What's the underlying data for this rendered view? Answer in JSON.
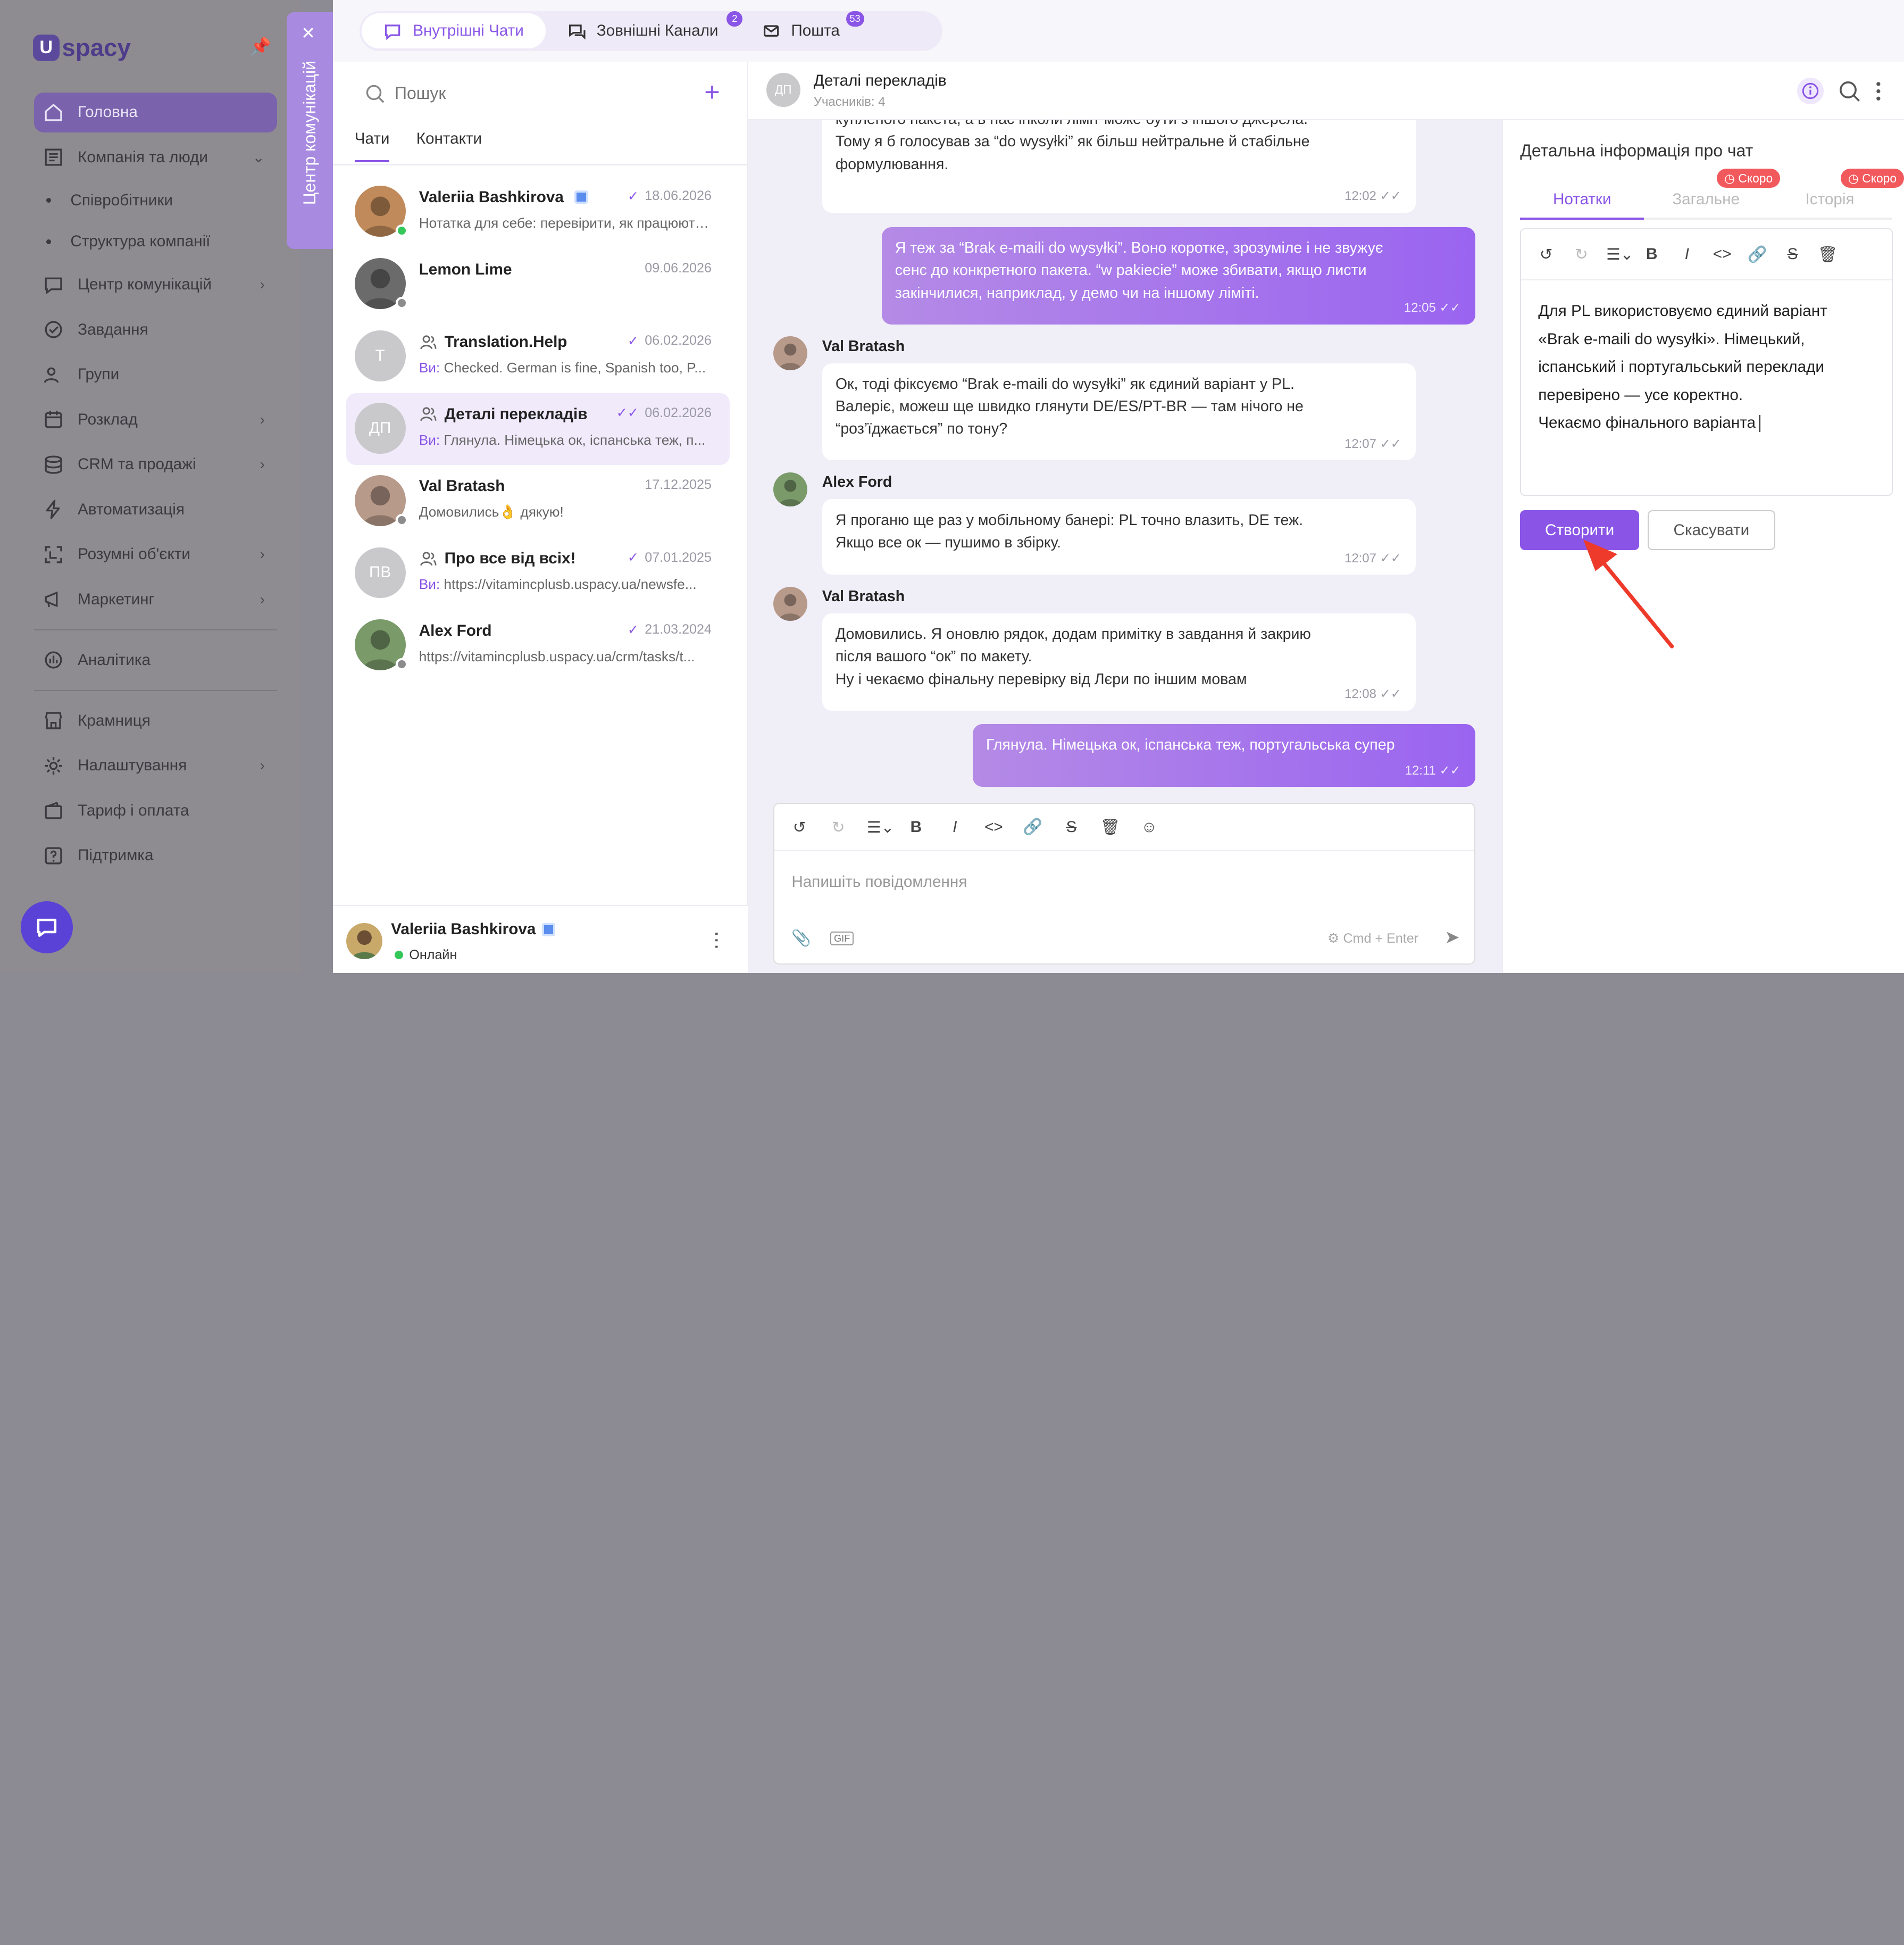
{
  "sidebar": {
    "logo_text": "spacy",
    "logo_mark": "U",
    "items": [
      {
        "label": "Головна",
        "icon": "home-icon",
        "active": true
      },
      {
        "label": "Компанія та люди",
        "icon": "company-icon",
        "expanded": true
      },
      {
        "label": "Співробітники",
        "sub": true
      },
      {
        "label": "Структура компанії",
        "sub": true
      },
      {
        "label": "Центр комунікацій",
        "icon": "chat-icon"
      },
      {
        "label": "Завдання",
        "icon": "check-circle-icon"
      },
      {
        "label": "Групи",
        "icon": "groups-icon"
      },
      {
        "label": "Розклад",
        "icon": "calendar-icon"
      },
      {
        "label": "CRM та продажі",
        "icon": "coins-icon"
      },
      {
        "label": "Автоматизація",
        "icon": "bolt-icon"
      },
      {
        "label": "Розумні об'єкти",
        "icon": "smart-object-icon"
      },
      {
        "label": "Маркетинг",
        "icon": "marketing-icon"
      },
      {
        "label": "Аналітика",
        "icon": "analytics-icon"
      },
      {
        "label": "Крамниця",
        "icon": "store-icon"
      },
      {
        "label": "Налаштування",
        "icon": "gear-icon"
      },
      {
        "label": "Тариф і оплата",
        "icon": "wallet-icon"
      },
      {
        "label": "Підтримка",
        "icon": "help-icon"
      }
    ]
  },
  "comm_center_tab": "Центр комунікацій",
  "tabs": [
    {
      "label": "Внутрішні Чати",
      "active": true,
      "badge": ""
    },
    {
      "label": "Зовнішні Канали",
      "badge": "2"
    },
    {
      "label": "Пошта",
      "badge": "53"
    }
  ],
  "chatlist": {
    "search_placeholder": "Пошук",
    "subtabs": [
      "Чати",
      "Контакти"
    ],
    "items": [
      {
        "name": "Valeriia Bashkirova",
        "date": "18.06.2026",
        "preview": "Нотатка для себе: перевірити, як працюють...",
        "read": true,
        "online": true,
        "avatar": "VB",
        "vi": ""
      },
      {
        "name": "Lemon Lime",
        "date": "09.06.2026",
        "preview": "",
        "online": false,
        "avatar": "LL",
        "vi": ""
      },
      {
        "name": "Translation.Help",
        "date": "06.02.2026",
        "preview": "Checked. German is fine, Spanish too, P...",
        "group": true,
        "read": true,
        "avatar": "Т",
        "vi": "Ви:"
      },
      {
        "name": "Деталі перекладів",
        "date": "06.02.2026",
        "preview": "Глянула. Німецька ок, іспанська теж, п...",
        "group": true,
        "read": true,
        "selected": true,
        "avatar": "ДП",
        "vi": "Ви:"
      },
      {
        "name": "Val Bratash",
        "date": "17.12.2025",
        "preview": "Домовились👌 дякую!",
        "online": false,
        "avatar": "VB",
        "vi": ""
      },
      {
        "name": "Про все від всіх!",
        "date": "07.01.2025",
        "preview": "https://vitamincplusb.uspacy.ua/newsfe...",
        "group": true,
        "read": true,
        "avatar": "ПВ",
        "vi": "Ви:"
      },
      {
        "name": "Alex Ford",
        "date": "21.03.2024",
        "preview": "https://vitamincplusb.uspacy.ua/crm/tasks/t...",
        "read": true,
        "online": false,
        "avatar": "AF",
        "vi": ""
      }
    ],
    "me": {
      "name": "Valeriia Bashkirova",
      "status": "Онлайн"
    }
  },
  "chat": {
    "avatar": "ДП",
    "title": "Деталі перекладів",
    "members": "Учасників: 4",
    "messages": [
      {
        "mine": false,
        "lines": [
          "купленого пакета, а в нас інколи ліміт може бути з іншого джерела.",
          "Тому я б голосував за “do wysyłki” як більш нейтральне й стабільне",
          "формулювання."
        ],
        "time": "12:02"
      },
      {
        "mine": true,
        "lines": [
          "Я теж за “Brak e-maili do wysyłki”. Воно коротке, зрозуміле і не звужує",
          "сенс до конкретного пакета. “w pakiecie” може збивати, якщо листи",
          "закінчилися, наприклад, у демо чи на іншому ліміті."
        ],
        "time": "12:05"
      },
      {
        "mine": false,
        "author": "Val Bratash",
        "lines": [
          "Ок, тоді фіксуємо “Brak e-maili do wysyłki” як єдиний варіант у PL.",
          "Валеріє, можеш ще швидко глянути DE/ES/PT-BR — там нічого не",
          "“роз’їджається” по тону?"
        ],
        "time": "12:07"
      },
      {
        "mine": false,
        "author": "Alex Ford",
        "lines": [
          "Я проганю ще раз у мобільному банері: PL точно влазить, DE теж.",
          "Якщо все ок — пушимо в збірку."
        ],
        "time": "12:07"
      },
      {
        "mine": false,
        "author": "Val Bratash",
        "lines": [
          "Домовились. Я оновлю рядок, додам примітку в завдання й закрию",
          "після вашого “ок” по макету.",
          "Ну і чекаємо фінальну перевірку від Лєри по іншим мовам"
        ],
        "time": "12:08"
      },
      {
        "mine": true,
        "lines": [
          "Глянула. Німецька ок, іспанська теж, португальська супер"
        ],
        "time": "12:11"
      }
    ],
    "composer": {
      "placeholder": "Напишіть повідомлення",
      "hint": "Cmd + Enter",
      "gif": "GIF"
    }
  },
  "details": {
    "title": "Детальна інформація про чат",
    "tabs": [
      {
        "label": "Нотатки",
        "active": true
      },
      {
        "label": "Загальне",
        "soon": "Скоро"
      },
      {
        "label": "Історія",
        "soon": "Скоро"
      }
    ],
    "note_lines": [
      "Для PL використовуємо єдиний варіант",
      "«Brak e-maili do wysyłki». Німецький,",
      "іспанський і португальський переклади",
      "перевірено — усе коректно.",
      "Чекаємо фінального варіанта"
    ],
    "create": "Створити",
    "cancel": "Скасувати"
  },
  "colors": {
    "accent": "#8a55e6",
    "sidebar_active": "#7a62ad",
    "soon": "#f2595c",
    "online": "#34c759"
  }
}
